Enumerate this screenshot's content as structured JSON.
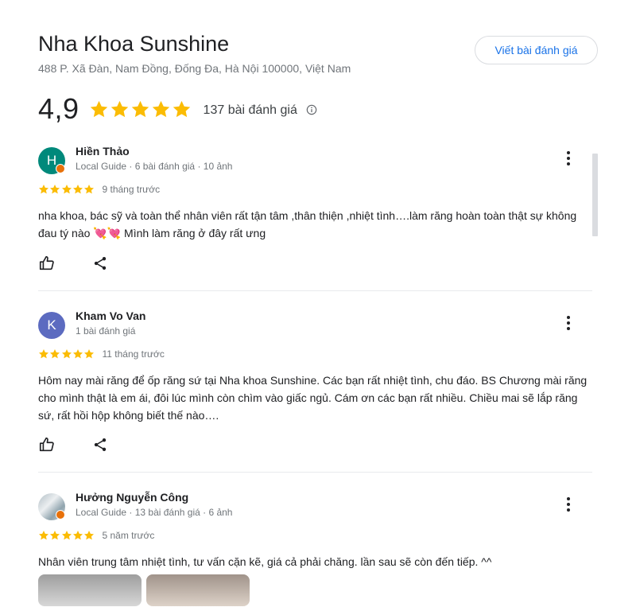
{
  "business": {
    "name": "Nha Khoa Sunshine",
    "address": "488 P. Xã Đàn, Nam Đồng, Đống Đa, Hà Nội 100000, Việt Nam",
    "write_review_label": "Viết bài đánh giá",
    "rating": "4,9",
    "rating_stars": 5,
    "review_count": "137 bài đánh giá"
  },
  "colors": {
    "star": "#fbbc04",
    "accent": "#1a73e8",
    "guide_badge": "#e8710a"
  },
  "reviews": [
    {
      "avatar_letter": "H",
      "avatar_color": "#00897b",
      "local_guide": true,
      "name": "Hiền Thảo",
      "meta": "Local Guide · 6 bài đánh giá · 10 ảnh",
      "stars": 5,
      "time": "9 tháng trước",
      "text": "nha khoa, bác sỹ và toàn thể nhân viên rất tận tâm ,thân thiện ,nhiệt tình….làm răng hoàn toàn thật sự không đau tý nào 💘💘 Mình làm răng ở đây rất ưng"
    },
    {
      "avatar_letter": "K",
      "avatar_color": "#5c6bc0",
      "local_guide": false,
      "name": "Kham Vo Van",
      "meta": "1 bài đánh giá",
      "stars": 5,
      "time": "11 tháng trước",
      "text": "Hôm nay mài răng để ốp răng sứ tại Nha khoa Sunshine. Các bạn rất nhiệt tình, chu đáo. BS Chương mài răng cho mình thật là em ái, đôi lúc mình còn chìm vào giấc ngủ. Cám ơn các bạn rất nhiều. Chiều mai sẽ lắp răng sứ, rất hồi hộp không biết thế nào…."
    },
    {
      "avatar_letter": "",
      "avatar_color": "#90a4ae",
      "local_guide": true,
      "name": "Hưởng Nguyễn Công",
      "meta": "Local Guide · 13 bài đánh giá · 6 ảnh",
      "stars": 5,
      "time": "5 năm trước",
      "text": "Nhân viên trung tâm nhiệt tình, tư vấn cặn kẽ, giá cả phải chăng. lần sau sẽ còn đến tiếp. ^^"
    }
  ]
}
